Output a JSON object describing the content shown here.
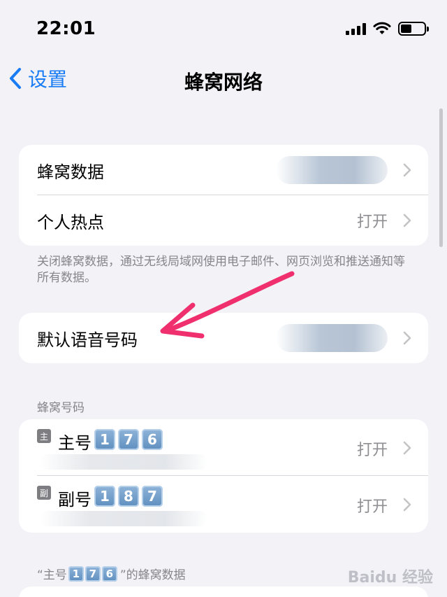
{
  "status_bar": {
    "time": "22:01"
  },
  "nav": {
    "back_label": "设置",
    "title": "蜂窝网络"
  },
  "group1": {
    "rows": [
      {
        "label": "蜂窝数据",
        "value": ""
      },
      {
        "label": "个人热点",
        "value": "打开"
      }
    ],
    "footnote": "关闭蜂窝数据，通过无线局域网使用电子邮件、网页浏览和推送通知等所有数据。"
  },
  "group2": {
    "rows": [
      {
        "label": "默认语音号码",
        "value": ""
      }
    ]
  },
  "section_numbers": {
    "header": "蜂窝号码",
    "rows": [
      {
        "badge": "主",
        "label": "主号",
        "digits": [
          "1",
          "7",
          "6"
        ],
        "value": "打开"
      },
      {
        "badge": "副",
        "label": "副号",
        "digits": [
          "1",
          "8",
          "7"
        ],
        "value": "打开"
      }
    ]
  },
  "section_data": {
    "header_prefix": "“主号",
    "header_digits": [
      "1",
      "7",
      "6"
    ],
    "header_suffix": "”的蜂窝数据"
  },
  "watermark": "Baidu 经验",
  "colors": {
    "accent": "#1a7cf5",
    "arrow": "#f0306e",
    "background": "#f2f2f7"
  },
  "icons": [
    "signal-icon",
    "wifi-icon",
    "battery-icon",
    "back-chevron-icon",
    "chevron-right-icon"
  ]
}
